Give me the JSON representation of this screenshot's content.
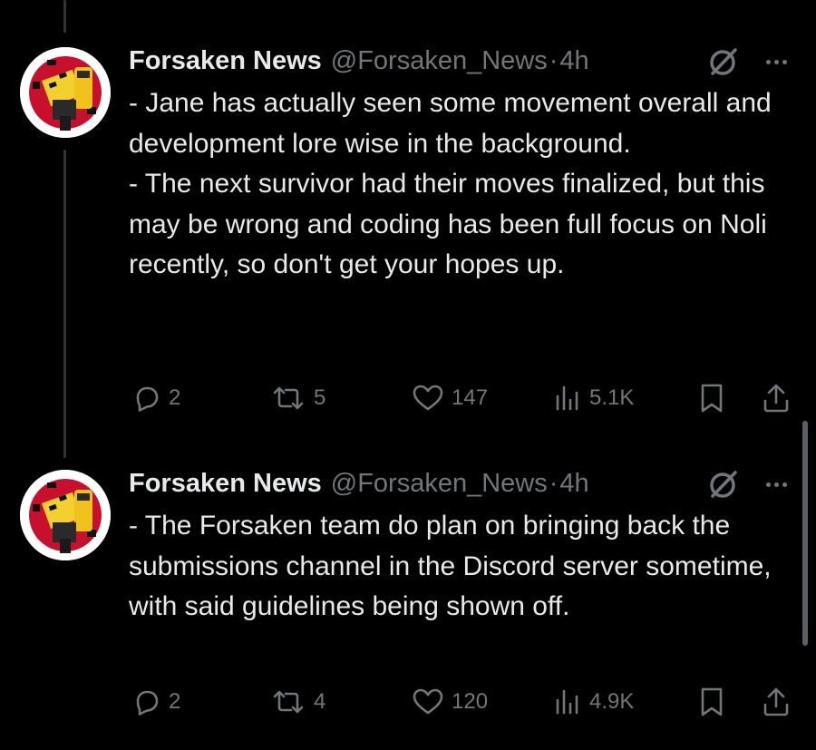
{
  "posts": [
    {
      "author": "Forsaken News",
      "handle": "@Forsaken_News",
      "separator": "·",
      "time": "4h",
      "lines": [
        "- Jane has actually seen some movement overall and development lore wise in the background.",
        "- The next survivor had their moves finalized, but this may be wrong and coding has been full focus on Noli recently, so don't get your hopes up."
      ],
      "replies": "2",
      "reposts": "5",
      "likes": "147",
      "views": "5.1K",
      "icons": [
        "reply-icon",
        "repost-icon",
        "like-icon",
        "views-icon",
        "bookmark-icon",
        "share-icon",
        "grok-icon",
        "more-icon"
      ]
    },
    {
      "author": "Forsaken News",
      "handle": "@Forsaken_News",
      "separator": "·",
      "time": "4h",
      "lines": [
        "- The Forsaken team do plan on bringing back the submissions channel in the Discord server sometime, with said guidelines being shown off."
      ],
      "replies": "2",
      "reposts": "4",
      "likes": "120",
      "views": "4.9K",
      "icons": [
        "reply-icon",
        "repost-icon",
        "like-icon",
        "views-icon",
        "bookmark-icon",
        "share-icon",
        "grok-icon",
        "more-icon"
      ]
    }
  ],
  "colors": {
    "background": "#000000",
    "text": "#e7e9ea",
    "secondary": "#71767b",
    "thread_line": "#333639"
  }
}
